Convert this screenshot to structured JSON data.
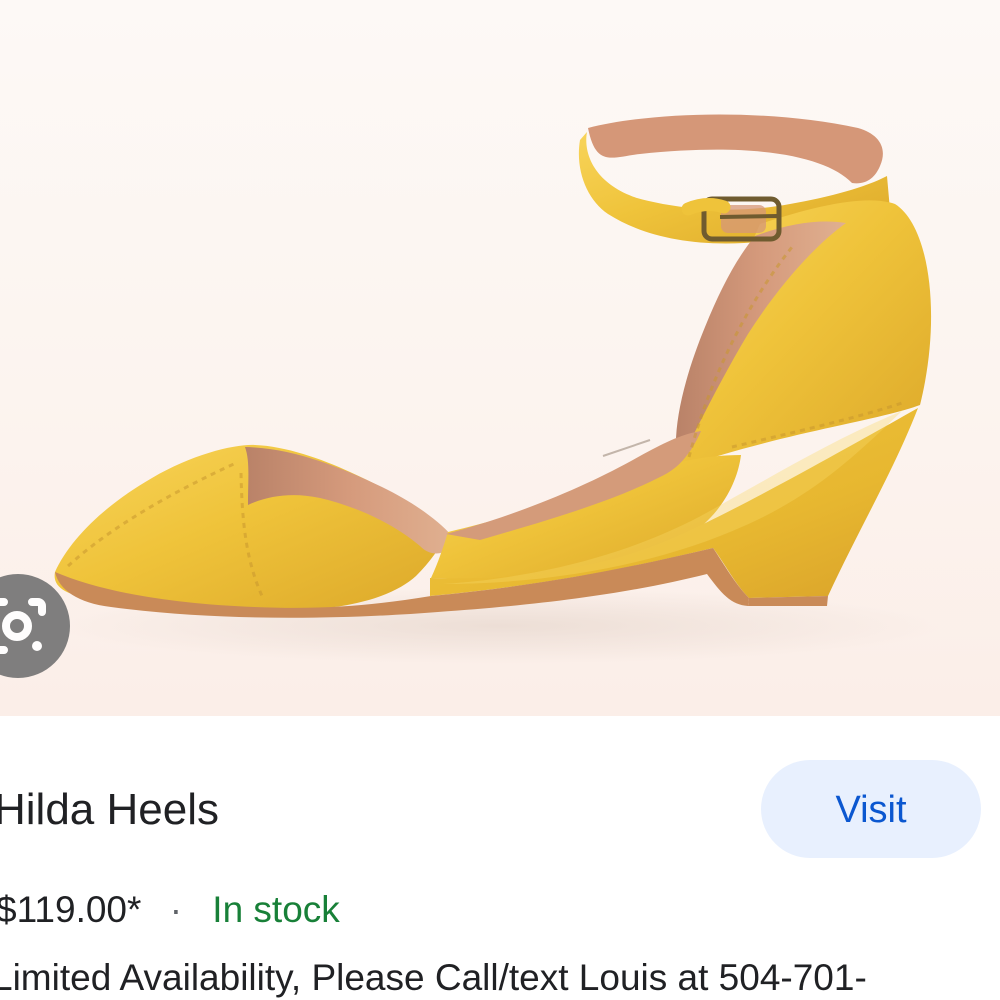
{
  "product": {
    "image_alt": "Yellow open-toe wedge sandal with ankle strap",
    "title": "Hilda Heels",
    "price": "$119.00*",
    "separator": "·",
    "stock_status": "In stock",
    "description": "Limited Availability, Please Call/text Louis at 504-701-"
  },
  "actions": {
    "visit_label": "Visit",
    "lens_icon": "google-lens-icon"
  },
  "colors": {
    "visit_button_background": "#e8f0fe",
    "visit_button_text": "#0b57d0",
    "stock_text": "#188038",
    "shoe_leather": "#efc33a",
    "shoe_shadow": "#d9a92a",
    "shoe_lining": "#cf8e72"
  }
}
